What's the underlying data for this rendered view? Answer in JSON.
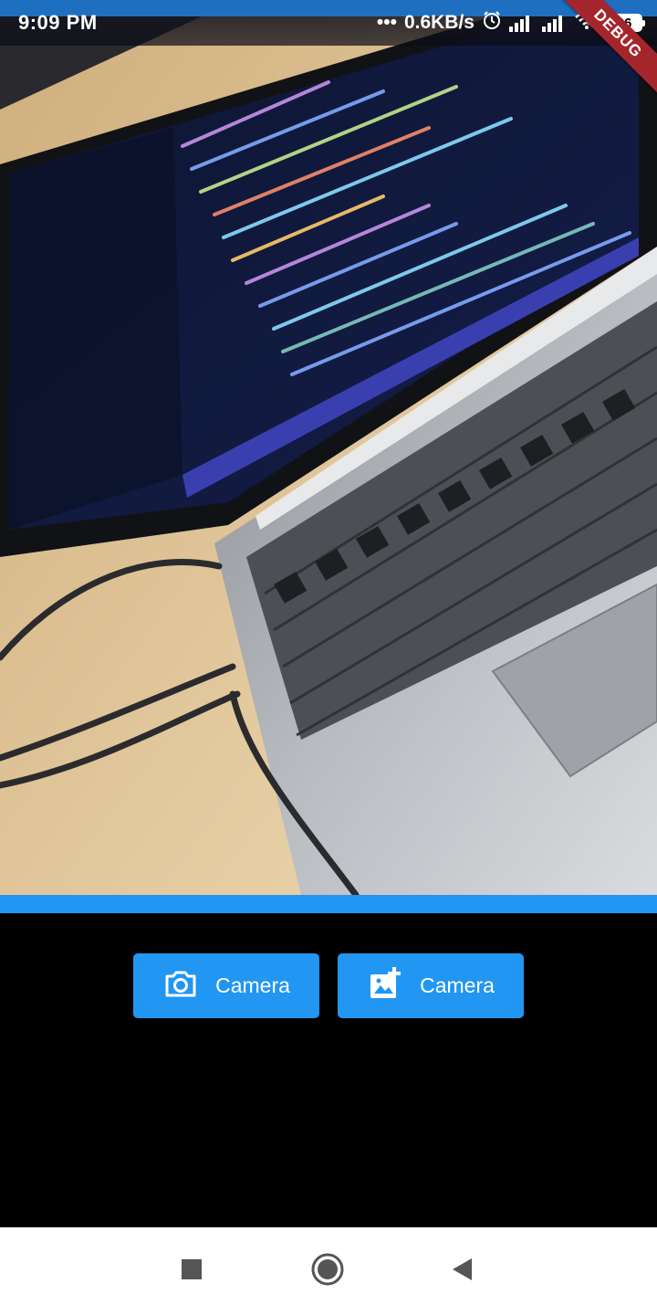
{
  "status_bar": {
    "time": "9:09 PM",
    "network_speed": "0.6KB/s",
    "battery_level": "26",
    "icons": [
      "dots-icon",
      "alarm-icon",
      "signal-icon",
      "signal-icon",
      "wifi-icon",
      "battery-icon"
    ]
  },
  "debug_banner": {
    "label": "DEBUG"
  },
  "buttons": {
    "camera": {
      "label": "Camera",
      "icon": "camera-icon"
    },
    "gallery": {
      "label": "Camera",
      "icon": "add-photo-icon"
    }
  },
  "nav_bar": {
    "icons": [
      "recents-square-icon",
      "home-circle-icon",
      "back-triangle-icon"
    ]
  },
  "colors": {
    "accent": "#2196f3",
    "debug_banner": "#a4262c",
    "background": "#000000",
    "nav_bar": "#ffffff"
  }
}
